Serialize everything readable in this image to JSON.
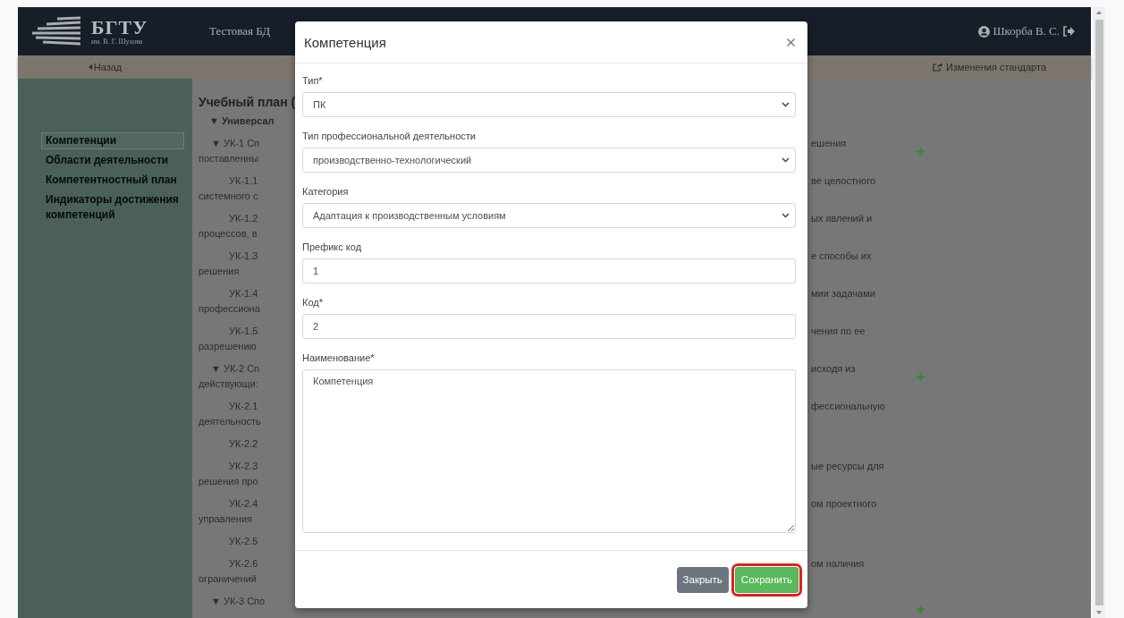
{
  "header": {
    "logo_title": "БГТУ",
    "logo_subtitle": "им. В. Г. Шухова",
    "database": "Тестовая БД",
    "user": "Шкорба В. С."
  },
  "subbar": {
    "back": "Назад",
    "changes": "Изменения стандарта"
  },
  "sidebar": {
    "items": [
      {
        "label": "Компетенции",
        "selected": true
      },
      {
        "label": "Области деятельности",
        "selected": false
      },
      {
        "label": "Компетентностный план",
        "selected": false
      },
      {
        "label": "Индикаторы достижения компетенций",
        "selected": false
      }
    ]
  },
  "content": {
    "title": "Учебный план (",
    "group": "▼ Универсал",
    "rows": [
      {
        "kind": "competence",
        "line1": "▼ УК-1 Сп",
        "line2": "поставленны",
        "right": "ешения",
        "add": true
      },
      {
        "kind": "indicator",
        "line1": "УК-1.1",
        "line2": "системного с",
        "right": "ве целостного"
      },
      {
        "kind": "indicator",
        "line1": "УК-1.2",
        "line2": "процессов, в",
        "right": "ых явлений и"
      },
      {
        "kind": "indicator",
        "line1": "УК-1.3",
        "line2": "решения",
        "right": "е способы их"
      },
      {
        "kind": "indicator",
        "line1": "УК-1.4",
        "line2": "профессиона",
        "right": "мии задачами"
      },
      {
        "kind": "indicator",
        "line1": "УК-1.5",
        "line2": "разрешению",
        "right": "чения по ее"
      },
      {
        "kind": "competence",
        "line1": "▼ УК-2 Сп",
        "line2": "действующи:",
        "right": "исходя из",
        "add": true
      },
      {
        "kind": "indicator",
        "line1": "УК-2.1",
        "line2": "деятельность",
        "right": "фессиональную"
      },
      {
        "kind": "indicator",
        "line1": "УК-2.2"
      },
      {
        "kind": "indicator",
        "line1": "УК-2.3",
        "line2": "решения про",
        "right": "ые ресурсы для"
      },
      {
        "kind": "indicator",
        "line1": "УК-2.4",
        "line2": "управления",
        "right": "ом проектного"
      },
      {
        "kind": "indicator",
        "line1": "УК-2.5"
      },
      {
        "kind": "indicator",
        "line1": "УК-2.6",
        "line2": "ограничений",
        "right": "ом наличия"
      },
      {
        "kind": "competence",
        "line1": "▼ УК-3 Спо",
        "add": true
      }
    ]
  },
  "modal": {
    "title": "Компетенция",
    "fields": [
      {
        "kind": "select",
        "label": "Тип*",
        "value": "ПК"
      },
      {
        "kind": "select",
        "label": "Тип профессиональной деятельности",
        "value": "производственно-технологический"
      },
      {
        "kind": "select",
        "label": "Категория",
        "value": "Адаптация к производственным условиям"
      },
      {
        "kind": "input",
        "label": "Префикс код",
        "value": "1"
      },
      {
        "kind": "input",
        "label": "Код*",
        "value": "2"
      },
      {
        "kind": "textarea",
        "label": "Наименование*",
        "value": "Компетенция"
      }
    ],
    "buttons": [
      {
        "kind": "secondary",
        "label": "Закрыть",
        "highlighted": false
      },
      {
        "kind": "primary",
        "label": "Сохранить",
        "highlighted": true
      }
    ]
  }
}
